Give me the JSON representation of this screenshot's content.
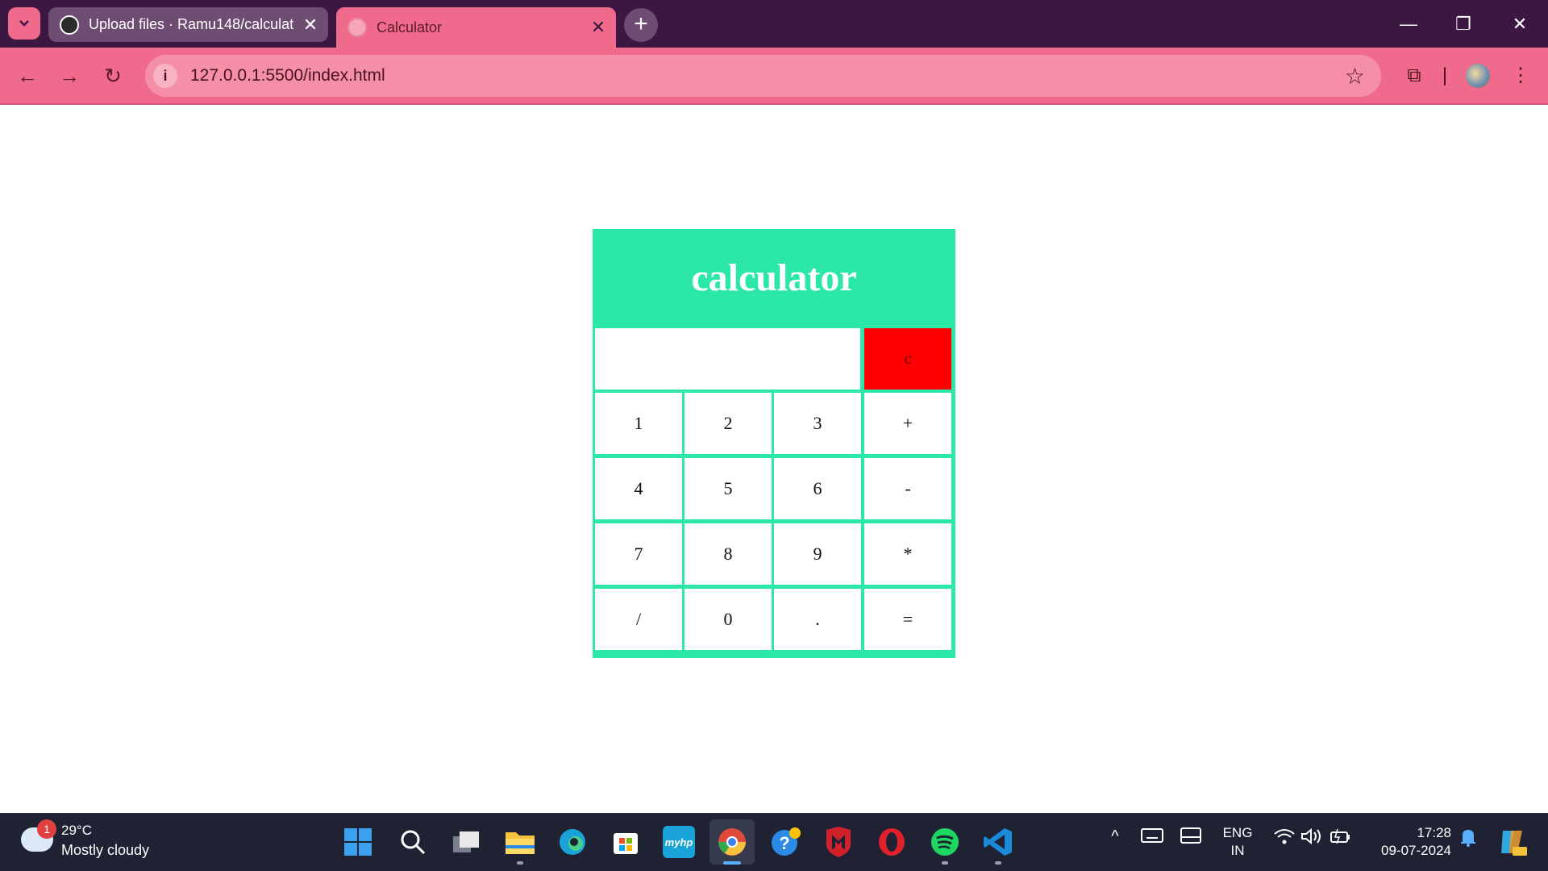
{
  "browser": {
    "tabs": [
      {
        "title": "Upload files · Ramu148/calculat",
        "close": "✕",
        "favicon": "github-icon"
      },
      {
        "title": "Calculator",
        "close": "✕",
        "favicon": "globe-icon"
      }
    ],
    "new_tab": "+",
    "window_controls": {
      "minimize": "—",
      "restore": "❐",
      "close": "✕"
    },
    "nav": {
      "back": "←",
      "forward": "→",
      "reload": "↻"
    },
    "address": {
      "info": "i",
      "url": "127.0.0.1:5500/index.html",
      "bookmark": "☆"
    },
    "toolbar_right": {
      "extensions": "⧉",
      "divider": "|",
      "menu": "⋮"
    },
    "colors": {
      "frame": "#3b1742",
      "toolbar": "#f06a8c",
      "omnibox": "#f48fa7"
    }
  },
  "calculator": {
    "title": "calculator",
    "display_value": "",
    "clear_label": "c",
    "keys": [
      [
        "1",
        "2",
        "3",
        "+"
      ],
      [
        "4",
        "5",
        "6",
        "-"
      ],
      [
        "7",
        "8",
        "9",
        "*"
      ],
      [
        "/",
        "0",
        ".",
        "="
      ]
    ],
    "colors": {
      "frame": "#2be8a9",
      "clear": "#ff0000",
      "cell": "#ffffff"
    }
  },
  "taskbar": {
    "weather": {
      "badge": "1",
      "temperature": "29°C",
      "condition": "Mostly cloudy"
    },
    "apps": [
      "windows-start-icon",
      "search-icon",
      "task-view-icon",
      "file-explorer-icon",
      "edge-icon",
      "store-icon",
      "myhp-icon",
      "chrome-icon",
      "help-icon",
      "mcafee-icon",
      "opera-icon",
      "spotify-icon",
      "vscode-icon"
    ],
    "myhp_label": "myhp",
    "tray": {
      "chevron": "^",
      "lang_line1": "ENG",
      "lang_line2": "IN",
      "time": "17:28",
      "date": "09-07-2024"
    }
  }
}
